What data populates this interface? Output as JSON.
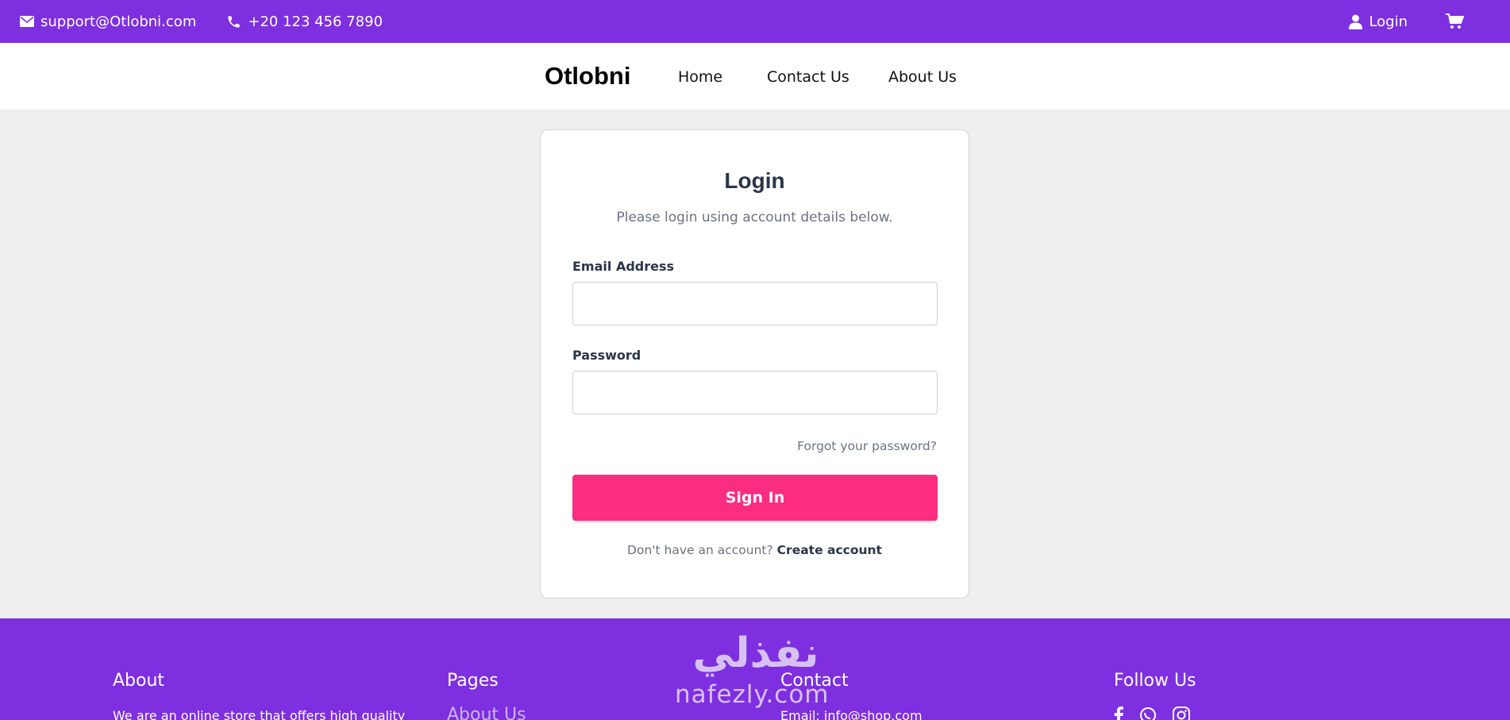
{
  "topbar": {
    "email": "support@Otlobni.com",
    "phone": "+20 123 456 7890",
    "login_label": "Login",
    "email_icon": "envelope-icon",
    "phone_icon": "phone-icon",
    "user_icon": "user-icon",
    "cart_icon": "cart-icon"
  },
  "nav": {
    "brand": "Otlobni",
    "links": [
      {
        "label": "Home"
      },
      {
        "label": "Contact Us"
      },
      {
        "label": "About Us"
      }
    ]
  },
  "login_form": {
    "title": "Login",
    "subtitle": "Please login using account details below.",
    "email_label": "Email Address",
    "email_value": "",
    "password_label": "Password",
    "password_value": "",
    "forgot_label": "Forgot your password?",
    "submit_label": "Sign In",
    "no_account_text": "Don't have an account?",
    "create_account_label": "Create account"
  },
  "footer": {
    "about": {
      "heading": "About",
      "text": "We are an online store that offers high quality"
    },
    "pages": {
      "heading": "Pages",
      "links": [
        {
          "label": "About Us"
        }
      ]
    },
    "contact": {
      "heading": "Contact",
      "email_text": "Email: info@shop.com"
    },
    "follow": {
      "heading": "Follow Us",
      "icons": [
        "facebook-icon",
        "whatsapp-icon",
        "instagram-icon"
      ]
    }
  },
  "watermark": {
    "arabic": "نفذلي",
    "latin": "nafezly.com"
  },
  "colors": {
    "brand_purple": "#7e2fdf",
    "signin_pink": "#fd2d81",
    "background": "#efefef",
    "heading_dark": "#2a3547"
  }
}
